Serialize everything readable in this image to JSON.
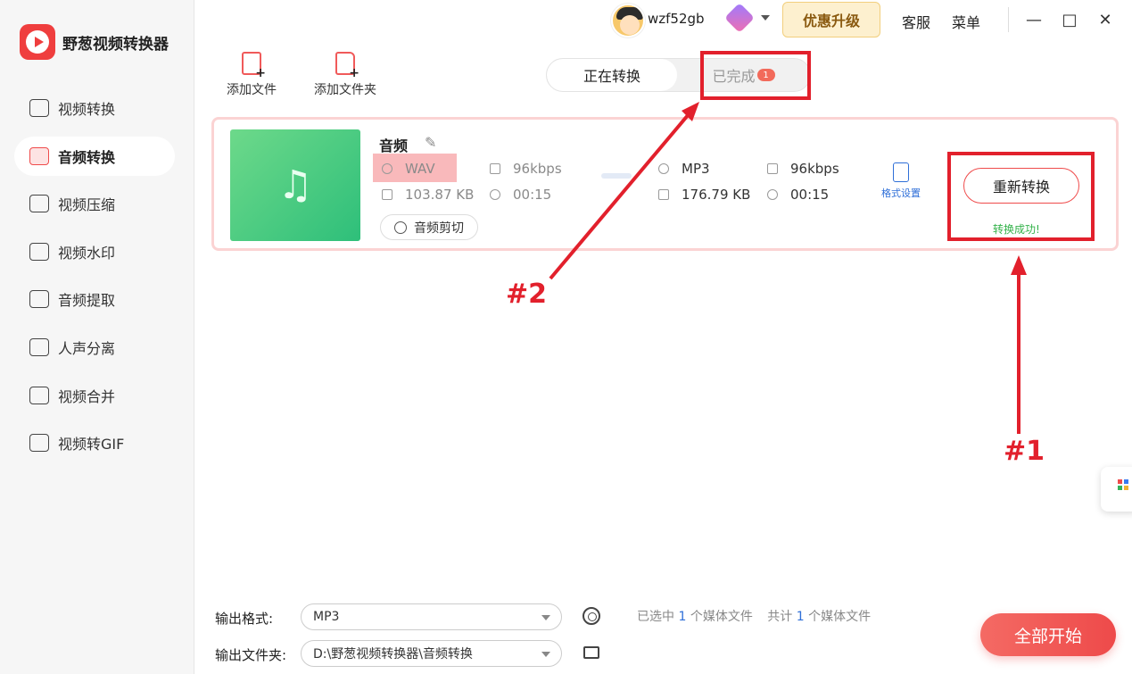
{
  "app": {
    "title": "野葱视频转换器"
  },
  "sidebar": {
    "items": [
      {
        "label": "视频转换",
        "icon": "video-convert-icon"
      },
      {
        "label": "音频转换",
        "icon": "audio-convert-icon",
        "active": true
      },
      {
        "label": "视频压缩",
        "icon": "video-compress-icon"
      },
      {
        "label": "视频水印",
        "icon": "watermark-icon"
      },
      {
        "label": "音频提取",
        "icon": "audio-extract-icon"
      },
      {
        "label": "人声分离",
        "icon": "voice-separate-icon"
      },
      {
        "label": "视频合并",
        "icon": "video-merge-icon"
      },
      {
        "label": "视频转GIF",
        "icon": "gif-icon"
      }
    ]
  },
  "titlebar": {
    "username": "wzf52gb",
    "upgrade_label": "优惠升级",
    "service_label": "客服",
    "menu_label": "菜单",
    "minimize": "—",
    "maximize": "□",
    "close": "✕"
  },
  "toolbar": {
    "add_file": "添加文件",
    "add_folder": "添加文件夹"
  },
  "tabs": {
    "converting": "正在转换",
    "done": "已完成",
    "done_count": "1"
  },
  "file": {
    "name": "音频",
    "source": {
      "format": "WAV",
      "bitrate": "96kbps",
      "size": "103.87 KB",
      "duration": "00:15"
    },
    "target": {
      "format": "MP3",
      "bitrate": "96kbps",
      "size": "176.79 KB",
      "duration": "00:15"
    },
    "clip_label": "音频剪切",
    "format_settings": "格式设置",
    "reconvert_label": "重新转换",
    "status": "转换成功!"
  },
  "annotations": {
    "one": "#1",
    "two": "#2"
  },
  "bottom": {
    "output_format_label": "输出格式:",
    "output_format_value": "MP3",
    "output_folder_label": "输出文件夹:",
    "output_folder_value": "D:\\野葱视频转换器\\音频转换",
    "selected_prefix": "已选中",
    "selected_count": "1",
    "selected_suffix": "个媒体文件",
    "total_prefix": "共计",
    "total_count": "1",
    "total_suffix": "个媒体文件",
    "start_label": "全部开始"
  },
  "colors": {
    "accent": "#ee4a4a",
    "annotation": "#e2202c",
    "success": "#33b24a",
    "link": "#2f6fd8"
  }
}
